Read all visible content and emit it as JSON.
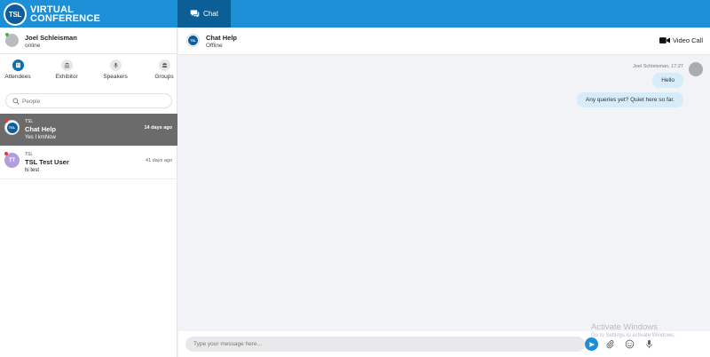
{
  "header": {
    "logo_badge": "TSL",
    "logo_line1": "VIRTUAL",
    "logo_line2": "CONFERENCE",
    "chat_tab_label": "Chat"
  },
  "user": {
    "name": "Joel Schleisman",
    "status": "online"
  },
  "nav": {
    "items": [
      {
        "label": "Attendees",
        "icon": "building-icon",
        "active": true
      },
      {
        "label": "Exhibitor",
        "icon": "bank-icon"
      },
      {
        "label": "Speakers",
        "icon": "microphone-icon"
      },
      {
        "label": "Groups",
        "icon": "group-icon"
      }
    ]
  },
  "search": {
    "placeholder": "People"
  },
  "conversations": [
    {
      "org": "TSL",
      "name": "Chat Help",
      "preview": "Yes I kmNow",
      "time": "14 days ago",
      "avatar_text": "TSL",
      "selected": true
    },
    {
      "org": "TSL",
      "name": "TSL Test User",
      "preview": "hi test",
      "time": "41 days ago",
      "avatar_text": "TT"
    }
  ],
  "chat": {
    "title": "Chat Help",
    "status": "Offline",
    "video_call_label": "Video Call",
    "message_meta": "Joel Schleisman, 17:27",
    "messages": [
      "Hello",
      "Any queries yet? Quiet here so far."
    ]
  },
  "composer": {
    "placeholder": "Type your message here..."
  },
  "watermark": {
    "line1": "Activate Windows",
    "line2": "Go to Settings to activate Windows."
  },
  "colors": {
    "topbar": "#1d8fd6",
    "active_tab": "#0b5f96",
    "selected_row": "#6b6b6b",
    "bubble": "#d6ecf8"
  }
}
